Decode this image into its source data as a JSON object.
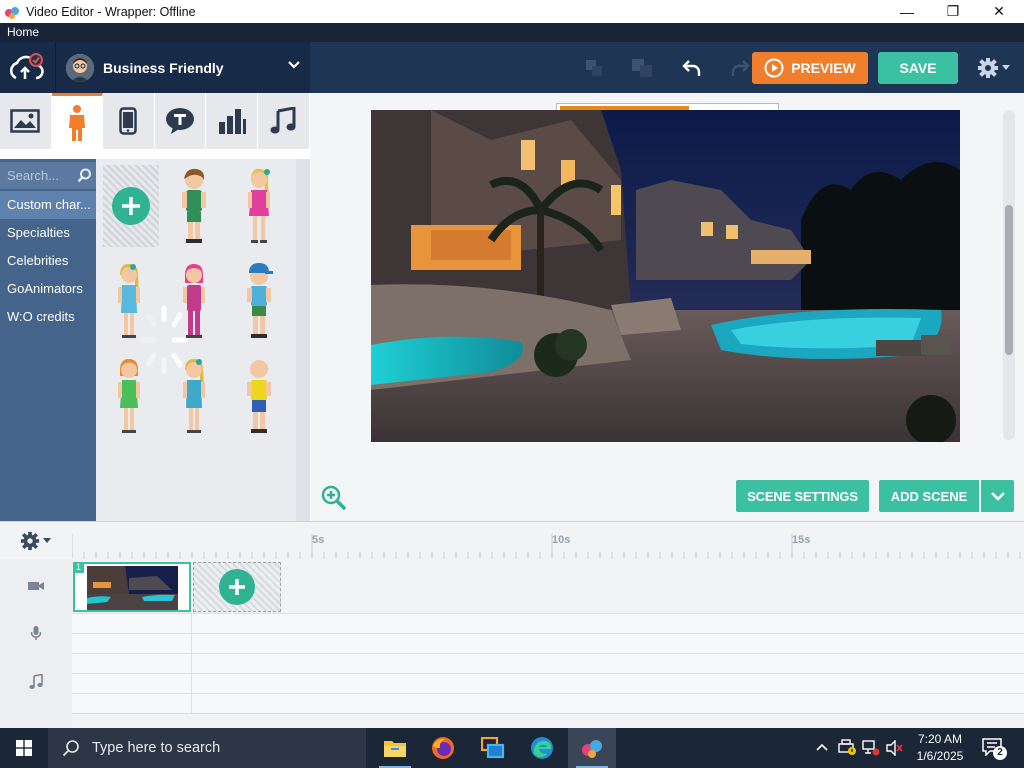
{
  "window": {
    "title": "Video Editor - Wrapper: Offline",
    "minimize_symbol": "—",
    "maximize_symbol": "❐",
    "close_symbol": "✕"
  },
  "menu": {
    "home": "Home"
  },
  "toolbar": {
    "theme_name": "Business Friendly",
    "preview_label": "PREVIEW",
    "save_label": "SAVE",
    "accent_orange": "#f07e2c",
    "accent_teal": "#3cc0a2"
  },
  "asset_tabs": [
    {
      "name": "backgrounds",
      "icon": "image-icon"
    },
    {
      "name": "characters",
      "icon": "person-icon",
      "active": true
    },
    {
      "name": "props",
      "icon": "phone-icon"
    },
    {
      "name": "text",
      "icon": "speech-bubble-icon"
    },
    {
      "name": "charts",
      "icon": "bar-chart-icon"
    },
    {
      "name": "sounds",
      "icon": "music-note-icon"
    }
  ],
  "asset_search": {
    "placeholder": "Search..."
  },
  "categories": [
    {
      "label": "Custom char...",
      "active": true
    },
    {
      "label": "Specialties"
    },
    {
      "label": "Celebrities"
    },
    {
      "label": "GoAnimators"
    },
    {
      "label": "W:O credits"
    }
  ],
  "characters": [
    {
      "name": "character-1"
    },
    {
      "name": "character-2"
    },
    {
      "name": "character-3"
    },
    {
      "name": "character-4"
    },
    {
      "name": "character-5"
    },
    {
      "name": "character-6"
    },
    {
      "name": "character-7"
    },
    {
      "name": "character-8"
    }
  ],
  "stage": {
    "loading_progress": 0.6
  },
  "stage_buttons": {
    "scene_settings": "SCENE SETTINGS",
    "add_scene": "ADD SCENE"
  },
  "timeline": {
    "ruler_labels": [
      "5s",
      "10s",
      "15s"
    ],
    "scene_number": "1"
  },
  "taskbar": {
    "search_placeholder": "Type here to search",
    "time": "7:20 AM",
    "date": "1/6/2025",
    "notification_count": "2"
  }
}
